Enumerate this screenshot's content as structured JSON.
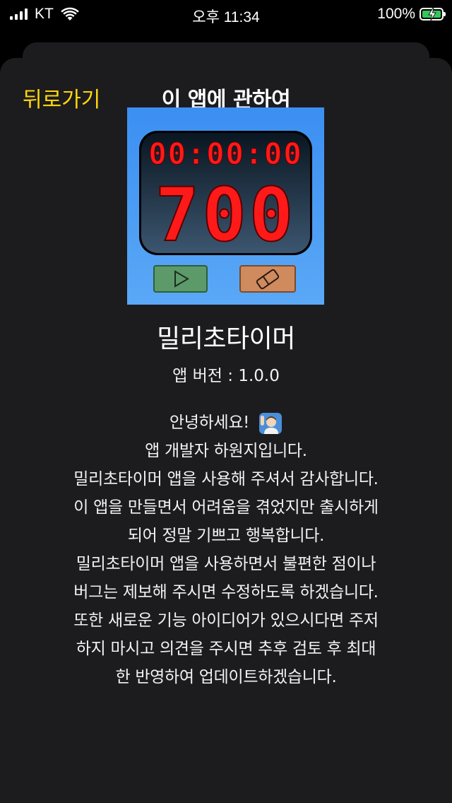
{
  "status_bar": {
    "carrier": "KT",
    "time": "오후 11:34",
    "battery_percent": "100%",
    "battery_level": 1.0,
    "signal_icon": "cellular-signal-icon",
    "wifi_icon": "wifi-icon",
    "battery_icon": "battery-charging-icon"
  },
  "nav": {
    "back_label": "뒤로가기",
    "title": "이 앱에 관하여"
  },
  "app": {
    "name": "밀리초타이머",
    "version": "앱 버전 : 1.0.0",
    "icon": {
      "timer_text": "00:00:00",
      "counter_text": "700",
      "play_icon": "play-icon",
      "eraser_icon": "eraser-icon"
    }
  },
  "description": {
    "greeting": "안녕하세요!",
    "greeting_emoji": "person-raising-hand-emoji",
    "lines": [
      "앱 개발자 하원지입니다.",
      "밀리초타이머 앱을 사용해 주셔서 감사합니다.",
      "이 앱을 만들면서 어려움을 겪었지만 출시하게",
      "되어 정말 기쁘고 행복합니다.",
      "밀리초타이머 앱을 사용하면서 불편한 점이나",
      "버그는 제보해 주시면 수정하도록 하겠습니다.",
      "또한 새로운 기능 아이디어가 있으시다면 주저",
      "하지 마시고 의견을 주시면 추후 검토 후 최대",
      "한 반영하여 업데이트하겠습니다."
    ]
  },
  "colors": {
    "accent": "#ffd60a",
    "sheet_background": "#1c1c1e",
    "icon_background": "#3b8ff2",
    "led_red": "#ff1a1a",
    "battery_green": "#34c759"
  }
}
